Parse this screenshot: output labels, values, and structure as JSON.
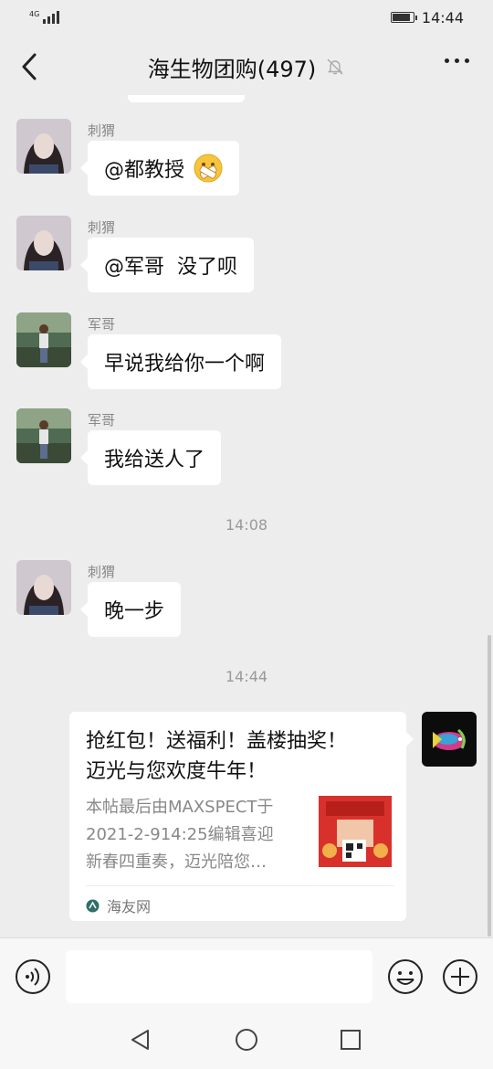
{
  "status_bar": {
    "network": "4G",
    "time": "14:44"
  },
  "header": {
    "title": "海生物团购(497)"
  },
  "messages": [
    {
      "sender": "刺猬",
      "text": "@都教授"
    },
    {
      "sender": "刺猬",
      "text": "@军哥  没了呗"
    },
    {
      "sender": "军哥",
      "text": "早说我给你一个啊"
    },
    {
      "sender": "军哥",
      "text": "我给送人了"
    },
    {
      "time": "14:08"
    },
    {
      "sender": "刺猬",
      "text": "晚一步"
    },
    {
      "time": "14:44"
    }
  ],
  "link_card": {
    "title_line1": "抢红包！送福利！盖楼抽奖！",
    "title_line2": "迈光与您欢度牛年！",
    "desc_line1": "本帖最后由MAXSPECT于",
    "desc_line2": "2021-2-914:25编辑喜迎",
    "desc_line3": "新春四重奏，迈光陪您…",
    "source": "海友网"
  },
  "icons": {
    "back": "chevron-left-icon",
    "mute": "bell-off-icon",
    "more": "more-dots-icon",
    "voice": "voice-icon",
    "emoji": "emoji-icon",
    "plus": "plus-icon",
    "nav_back": "triangle-back-icon",
    "nav_home": "circle-home-icon",
    "nav_recent": "square-recent-icon"
  },
  "colors": {
    "background": "#ededed",
    "bubble": "#ffffff",
    "meta_text": "#888888"
  }
}
